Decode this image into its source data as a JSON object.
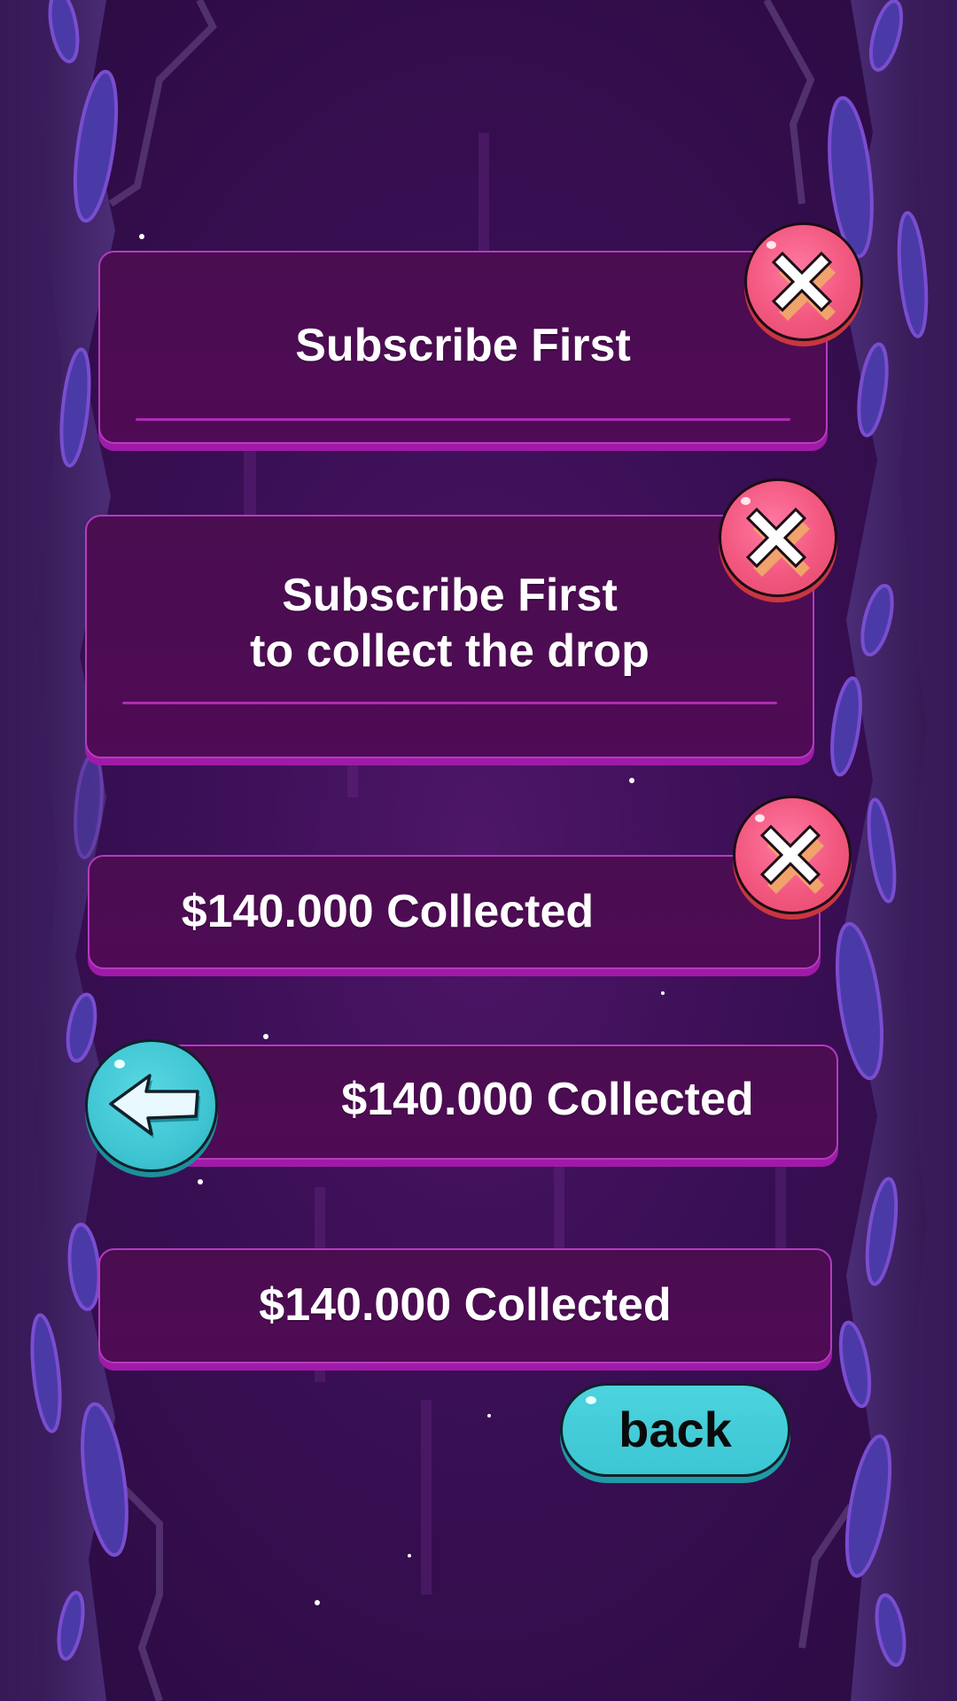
{
  "panels": [
    {
      "text": "Subscribe First"
    },
    {
      "line1": "Subscribe First",
      "line2": "to collect the drop"
    },
    {
      "text": "$140.000 Collected"
    },
    {
      "text": "$140.000 Collected"
    },
    {
      "text": "$140.000 Collected"
    }
  ],
  "buttons": {
    "back_label": "back",
    "close_icon": "close-icon",
    "arrow_icon": "arrow-left-icon"
  },
  "colors": {
    "panel": "#4a0d50",
    "panel_border": "#b43cc0",
    "close": "#f2577f",
    "back": "#3fc5d3"
  }
}
